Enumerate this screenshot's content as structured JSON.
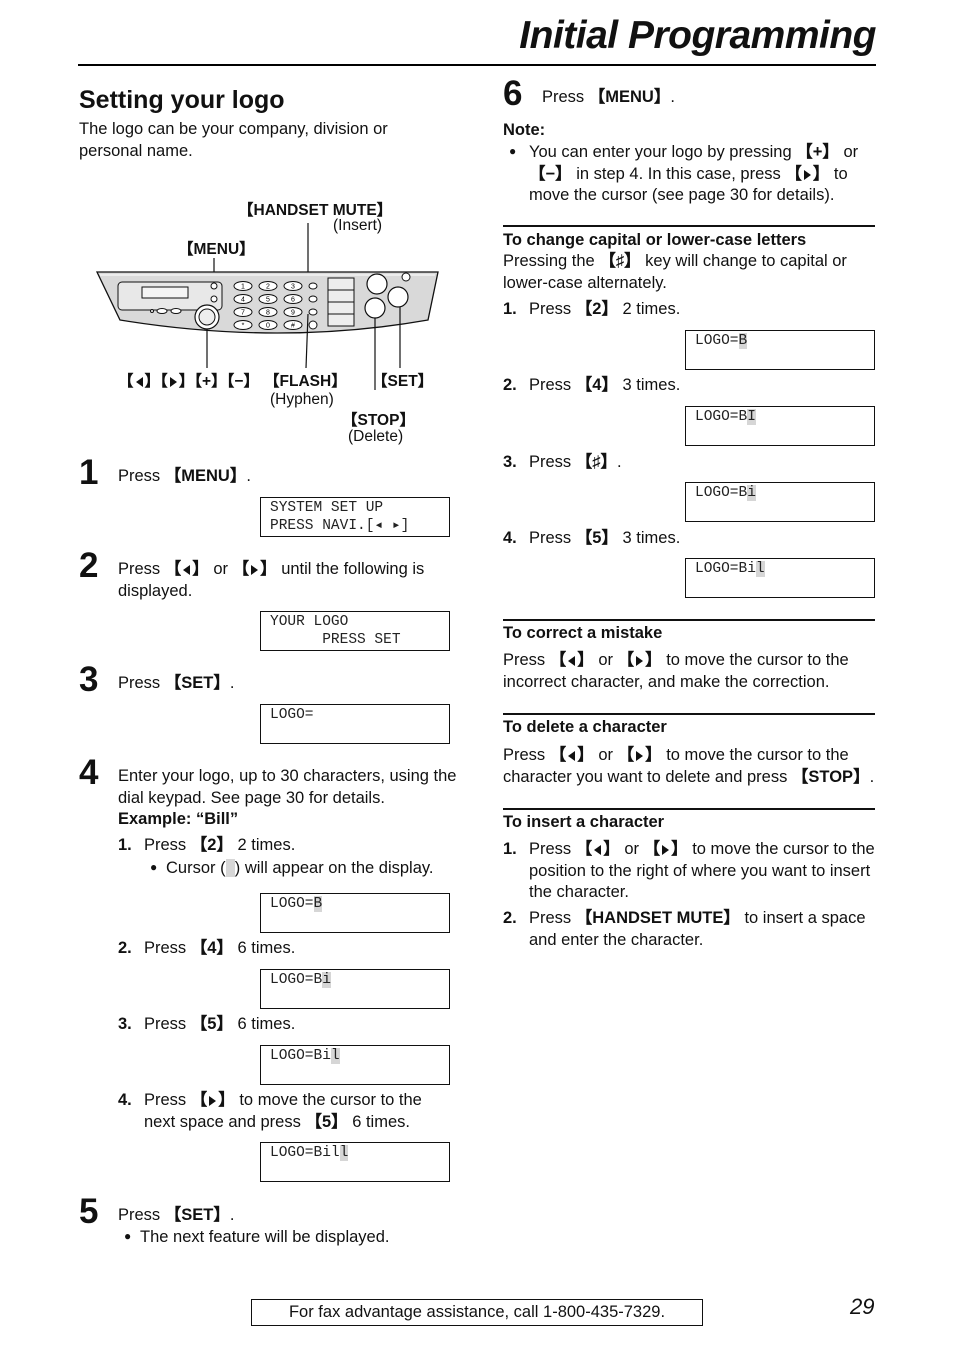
{
  "page": {
    "header_title": "Initial Programming",
    "page_number": "29",
    "footer_text": "For fax advantage assistance, call 1-800-435-7329."
  },
  "left": {
    "section_title": "Setting your logo",
    "intro": "The logo can be your company, division or personal name.",
    "diagram": {
      "labels": {
        "handset_mute": "HANDSET MUTE",
        "insert": "(Insert)",
        "menu": "MENU",
        "nav_keys": [
          "◄",
          "►",
          "+",
          "−"
        ],
        "flash": "FLASH",
        "hyphen": "(Hyphen)",
        "set": "SET",
        "stop": "STOP",
        "delete": "(Delete)"
      },
      "keypad": [
        "1",
        "2",
        "3",
        "4",
        "5",
        "6",
        "7",
        "8",
        "9",
        "*",
        "0",
        "#"
      ]
    },
    "steps": [
      {
        "num": "1",
        "prefix": "Press ",
        "key": "MENU",
        "suffix": ".",
        "lcd": [
          "SYSTEM SET UP",
          "PRESS NAVI.[◂ ▸]"
        ]
      },
      {
        "num": "2",
        "text_a": "Press ",
        "text_b": " or ",
        "text_c": " until the following is displayed.",
        "lcd": [
          "YOUR LOGO",
          "      PRESS SET"
        ]
      },
      {
        "num": "3",
        "prefix": "Press ",
        "key": "SET",
        "suffix": ".",
        "lcd": [
          "LOGO=",
          ""
        ]
      },
      {
        "num": "4",
        "text": "Enter your logo, up to 30 characters, using the dial keypad. See page 30 for details.",
        "example": "Example: “Bill”",
        "substeps": [
          {
            "num": "1.",
            "prefix": "Press ",
            "key": "2",
            "suffix": " 2 times.",
            "bullet_a": "Cursor (",
            "bullet_b": ") will appear on the display.",
            "lcd_text": "LOGO=",
            "lcd_cursor": "B"
          },
          {
            "num": "2.",
            "prefix": "Press ",
            "key": "4",
            "suffix": " 6 times.",
            "lcd_text": "LOGO=B",
            "lcd_cursor": "i"
          },
          {
            "num": "3.",
            "prefix": "Press ",
            "key": "5",
            "suffix": " 6 times.",
            "lcd_text": "LOGO=Bi",
            "lcd_cursor": "l"
          },
          {
            "num": "4.",
            "prefix": "Press ",
            "mid": " to move the cursor to the next space and press ",
            "key": "5",
            "suffix": " 6 times.",
            "lcd_text": "LOGO=Bil",
            "lcd_cursor": "l"
          }
        ]
      },
      {
        "num": "5",
        "prefix": "Press ",
        "key": "SET",
        "suffix": ".",
        "bullet": "The next feature will be displayed."
      }
    ]
  },
  "right": {
    "step6": {
      "num": "6",
      "prefix": "Press ",
      "key": "MENU",
      "suffix": "."
    },
    "note": {
      "title": "Note:",
      "a": "You can enter your logo by pressing ",
      "key_plus": "+",
      "b": " or ",
      "key_minus": "−",
      "c": " in step 4. In this case, press ",
      "d": " to move the cursor (see page 30 for details)."
    },
    "capital": {
      "title": "To change capital or lower-case letters",
      "text_a": "Pressing the ",
      "key": "♯",
      "text_b": " key will change to capital or lower-case alternately.",
      "substeps": [
        {
          "num": "1.",
          "prefix": "Press ",
          "key": "2",
          "suffix": " 2 times.",
          "lcd_text": "LOGO=",
          "lcd_cursor": "B"
        },
        {
          "num": "2.",
          "prefix": "Press ",
          "key": "4",
          "suffix": " 3 times.",
          "lcd_text": "LOGO=B",
          "lcd_cursor": "I"
        },
        {
          "num": "3.",
          "prefix": "Press ",
          "key": "♯",
          "suffix": ".",
          "lcd_text": "LOGO=B",
          "lcd_cursor": "i"
        },
        {
          "num": "4.",
          "prefix": "Press ",
          "key": "5",
          "suffix": " 3 times.",
          "lcd_text": "LOGO=Bi",
          "lcd_cursor": "l"
        }
      ]
    },
    "correct": {
      "title": "To correct a mistake",
      "a": "Press ",
      "b": " or ",
      "c": " to move the cursor to the incorrect character, and make the correction."
    },
    "delete": {
      "title": "To delete a character",
      "a": "Press ",
      "b": " or ",
      "c": " to move the cursor to the character you want to delete and press ",
      "key": "STOP",
      "d": "."
    },
    "insert": {
      "title": "To insert a character",
      "step1": {
        "num": "1.",
        "a": "Press ",
        "b": " or ",
        "c": " to move the cursor to the position to the right of where you want to insert the character."
      },
      "step2": {
        "num": "2.",
        "a": "Press ",
        "key": "HANDSET MUTE",
        "b": " to insert a space and enter the character."
      }
    }
  }
}
